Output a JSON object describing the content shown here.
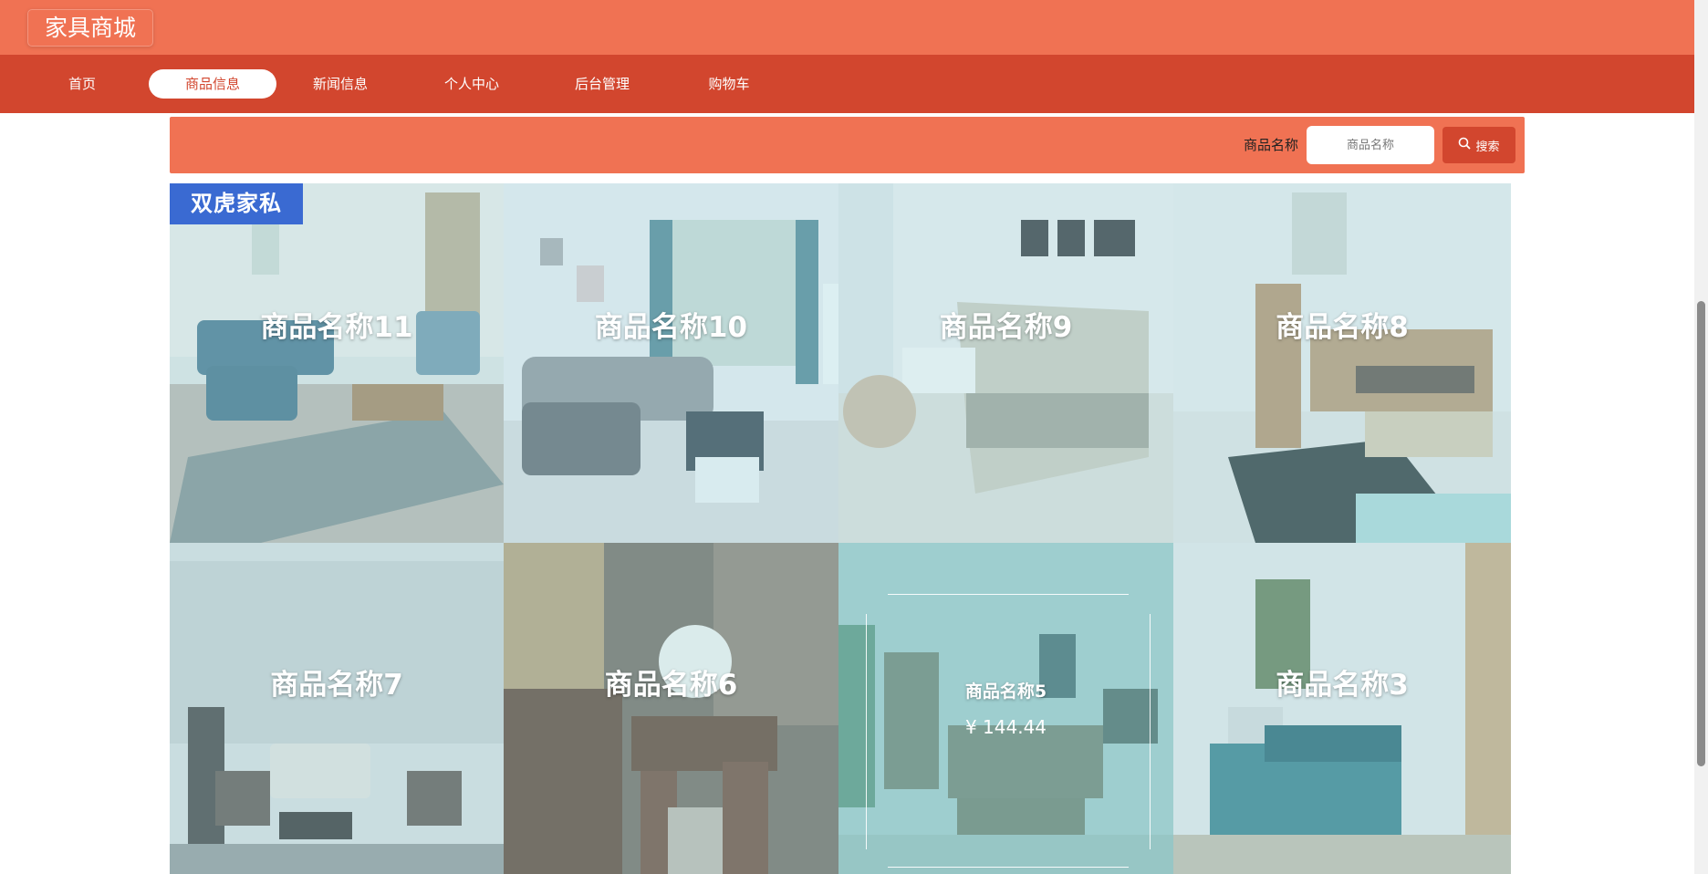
{
  "header": {
    "logo": "家具商城"
  },
  "nav": {
    "items": [
      {
        "label": "首页"
      },
      {
        "label": "商品信息"
      },
      {
        "label": "新闻信息"
      },
      {
        "label": "个人中心"
      },
      {
        "label": "后台管理"
      },
      {
        "label": "购物车"
      }
    ],
    "active_index": 1
  },
  "search": {
    "label": "商品名称",
    "placeholder": "商品名称",
    "button_label": "搜索"
  },
  "products": [
    {
      "name": "商品名称11",
      "brand_tag": "双虎家私"
    },
    {
      "name": "商品名称10"
    },
    {
      "name": "商品名称9"
    },
    {
      "name": "商品名称8"
    },
    {
      "name": "商品名称7"
    },
    {
      "name": "商品名称6"
    },
    {
      "name": "商品名称5",
      "price": "¥ 144.44"
    },
    {
      "name": "商品名称3"
    }
  ],
  "colors": {
    "header": "#f07253",
    "nav": "#d2462e",
    "brand_tag": "#3a6ad2"
  }
}
